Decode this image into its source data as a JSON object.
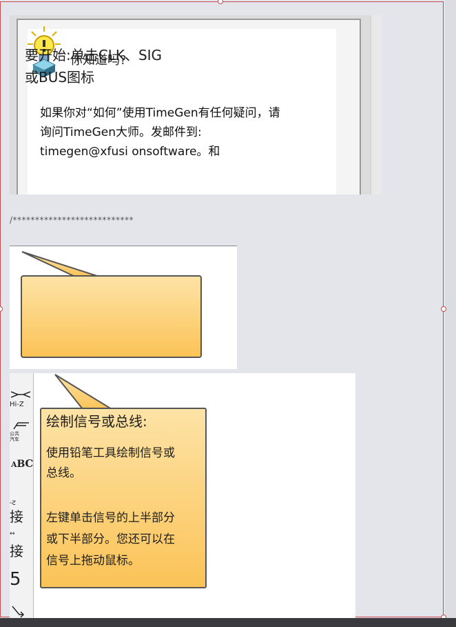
{
  "tip": {
    "heading": "你知道吗?",
    "lines": [
      "如果你对“如何”使用TimeGen有任何疑问，请",
      "询问TimeGen大师。发邮件到:",
      "timegen@xfusi onsoftware。和"
    ]
  },
  "separator": "/***************************",
  "start_callout": {
    "lines": [
      "要开始:单击CLK、SIG",
      "或BUS图标"
    ]
  },
  "draw_callout": {
    "title": "绘制信号或总线:",
    "para1": [
      "使用铅笔工具绘制信号或",
      "总线。"
    ],
    "para2": [
      "左键单击信号的上半部分",
      "或下半部分。您还可以在",
      "信号上拖动鼠标。"
    ]
  },
  "toolstrip": {
    "hiz_label": "Hi-Z",
    "bus_label": "公共汽车",
    "tool_a": "接",
    "tool_b": "接",
    "tool_num": "5",
    "tool_small": "-ट"
  },
  "colors": {
    "frame": "#c8494f",
    "callout_top": "#fde3a6",
    "callout_bottom": "#fbc357"
  }
}
